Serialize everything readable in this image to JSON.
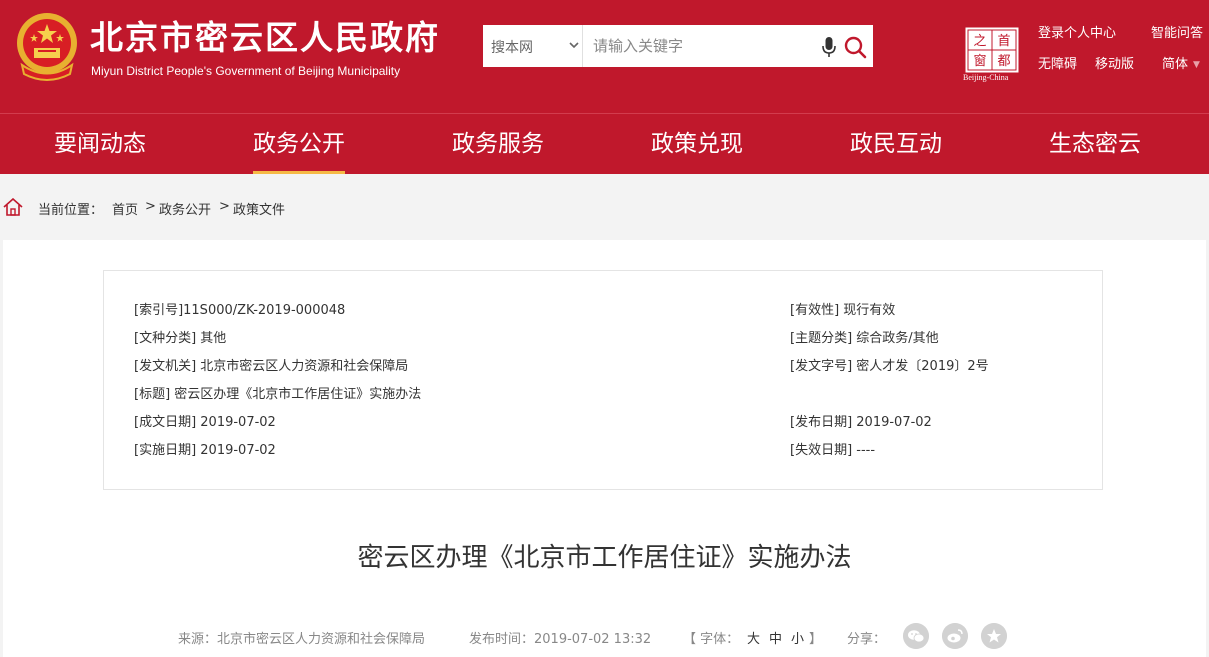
{
  "header": {
    "site_title": "北京市密云区人民政府",
    "site_subtitle": "Miyun District People's Government of Beijing Municipality",
    "capital_logo_chars": [
      "之",
      "首",
      "窗",
      "都"
    ],
    "capital_logo_caption": "Beijing-China",
    "links": {
      "login": "登录个人中心",
      "qa": "智能问答",
      "accessibility": "无障碍",
      "mobile": "移动版",
      "language": "简体"
    }
  },
  "search": {
    "scope": "搜本网",
    "placeholder": "请输入关键字"
  },
  "nav": {
    "items": [
      "要闻动态",
      "政务公开",
      "政务服务",
      "政策兑现",
      "政民互动",
      "生态密云"
    ],
    "active": "政务公开"
  },
  "breadcrumb": {
    "label": "当前位置：",
    "items": [
      "首页",
      "政务公开",
      "政策文件"
    ],
    "separator": ">"
  },
  "meta": {
    "index_no": "[索引号]11S000/ZK-2019-000048",
    "validity": "[有效性] 现行有效",
    "doc_type": "[文种分类] 其他",
    "topic": "[主题分类] 综合政务/其他",
    "issuer": "[发文机关] 北京市密云区人力资源和社会保障局",
    "doc_no": "[发文字号] 密人才发〔2019〕2号",
    "title": "[标题] 密云区办理《北京市工作居住证》实施办法",
    "written_date": "[成文日期] 2019-07-02",
    "publish_date": "[发布日期] 2019-07-02",
    "effective_date": "[实施日期] 2019-07-02",
    "expiry_date": "[失效日期] ----"
  },
  "article": {
    "title": "密云区办理《北京市工作居住证》实施办法"
  },
  "info_bar": {
    "source": "来源：北京市密云区人力资源和社会保障局",
    "publish_time": "发布时间：2019-07-02 13:32",
    "font_label": "【 字体：",
    "font_large": "大",
    "font_medium": "中",
    "font_small": "小",
    "font_close": "】",
    "share_label": "分享："
  },
  "colors": {
    "brand_red": "#c0182c",
    "nav_active_underline": "#f5b945",
    "search_accent": "#c0182c"
  },
  "icons": [
    "national-emblem-icon",
    "chevron-down-icon",
    "mic-icon",
    "search-icon",
    "capital-window-logo",
    "home-icon",
    "wechat-icon",
    "weibo-icon",
    "favorite-star-icon"
  ]
}
